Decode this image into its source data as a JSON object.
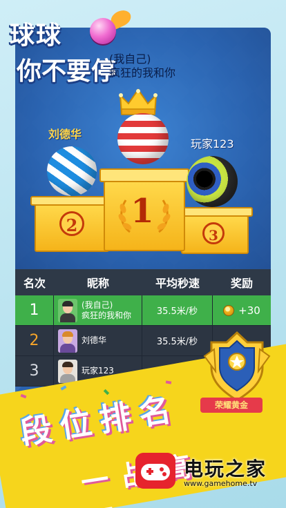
{
  "logo": {
    "line1": "球球",
    "line2": "你不要停"
  },
  "self_label": {
    "line1": "(我自己)",
    "line2": "疯狂的我和你"
  },
  "podium": {
    "second_name": "刘德华",
    "third_name": "玩家123",
    "numbers": [
      "2",
      "1",
      "3"
    ]
  },
  "table": {
    "headers": [
      "名次",
      "昵称",
      "平均秒速",
      "奖励"
    ],
    "rows": [
      {
        "rank": "1",
        "name_line1": "(我自己)",
        "name_line2": "疯狂的我和你",
        "speed": "35.5米/秒",
        "reward": "+30"
      },
      {
        "rank": "2",
        "name_line1": "刘德华",
        "name_line2": "",
        "speed": "35.5米/秒",
        "reward": ""
      },
      {
        "rank": "3",
        "name_line1": "玩家123",
        "name_line2": "",
        "speed": "",
        "reward": ""
      }
    ]
  },
  "badge": {
    "label": "荣耀黄金"
  },
  "banner": {
    "main": "段位排名",
    "sub": "一战高下"
  },
  "watermark": {
    "title": "电玩之家",
    "url": "www.gamehome.tv"
  },
  "colors": {
    "accent_yellow": "#f6d51c",
    "card_blue": "#2a63b0",
    "row_green": "#3fb04a"
  }
}
